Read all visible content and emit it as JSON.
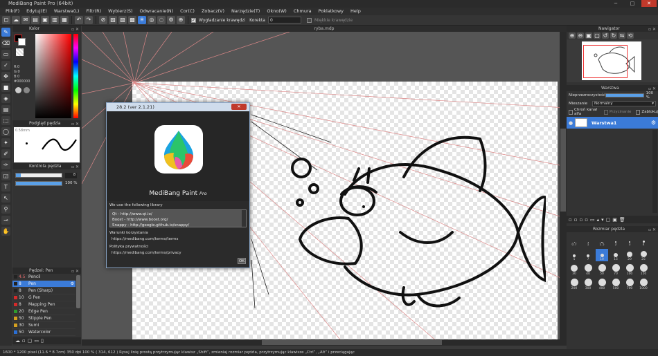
{
  "window": {
    "title": "MediBang Paint Pro (64bit)"
  },
  "window_controls": {
    "minimize": "─",
    "maximize": "□",
    "close": "✕"
  },
  "menu": [
    "Plik(F)",
    "Edytuj(E)",
    "Warstwa(L)",
    "Filtr(R)",
    "Wybierz(S)",
    "Odwracanie(N)",
    "Cor(C)",
    "Zobacz(V)",
    "Narzędzie(T)",
    "Okno(W)",
    "Chmura",
    "Poklatkowy",
    "Help"
  ],
  "toolbar": {
    "antialias_label": "Wygładzanie krawędzi",
    "correction_label": "Korekta",
    "correction_value": "0",
    "soft_edges_label": "Miękkie krawędzie"
  },
  "canvas": {
    "tab_title": "ryba.mdp"
  },
  "color_panel": {
    "title": "Kolor",
    "r": "R:0",
    "g": "G:0",
    "b": "B:0",
    "hex": "#000000"
  },
  "brush_preview": {
    "title": "Podgląd pędzla",
    "size": "0.58mm"
  },
  "brush_control": {
    "title": "Kontrola pędzla",
    "size_value": "8",
    "opacity_value": "100 %"
  },
  "brush_list": {
    "title": "Pędzel: Pen",
    "items": [
      {
        "size": "4.5",
        "name": "Pencil",
        "color": "#222222"
      },
      {
        "size": "8",
        "name": "Pen",
        "color": "#222222",
        "selected": true
      },
      {
        "size": "8",
        "name": "Pen (Sharp)",
        "color": "#222222"
      },
      {
        "size": "10",
        "name": "G Pen",
        "color": "#d42a2a"
      },
      {
        "size": "8",
        "name": "Mapping Pen",
        "color": "#d42a2a"
      },
      {
        "size": "20",
        "name": "Edge Pen",
        "color": "#2e9b2e"
      },
      {
        "size": "50",
        "name": "Stipple Pen",
        "color": "#d4a020"
      },
      {
        "size": "30",
        "name": "Sumi",
        "color": "#d4a020"
      },
      {
        "size": "50",
        "name": "Watercolor",
        "color": "#2a6fd4"
      }
    ]
  },
  "about_dialog": {
    "title": "28.2 (ver 2.1.21)",
    "close": "✕",
    "app_name": "MediBang Paint",
    "app_suffix": "Pro",
    "library_heading": "We use the following library",
    "libraries": [
      "Qt - http://www.qt.io/",
      "Boost - http://www.boost.org/",
      "Snappy - http://google.github.io/snappy/"
    ],
    "terms_label": "Warunki korzystania",
    "terms_url": "https://medibang.com/terms/terms",
    "privacy_label": "Polityka prywatności",
    "privacy_url": "https://medibang.com/terms/privacy",
    "ok": "OK"
  },
  "navigator": {
    "title": "Nawigator"
  },
  "layer_panel": {
    "title": "Warstwa",
    "opacity_label": "Nieprzezroczystość",
    "opacity_value": "100 %",
    "blend_label": "Mieszanie",
    "blend_value": "Normalny",
    "protect_alpha": "Chroń kanał alfa",
    "clipping": "Przycinanie",
    "lock": "Zablokuj",
    "layer_name": "Warstwa1"
  },
  "brush_size_panel": {
    "title": "Rozmiar pędzla",
    "sizes": [
      "1",
      "1.5",
      "2",
      "3",
      "4",
      "5",
      "7",
      "10",
      "15",
      "20",
      "25",
      "30",
      "40",
      "50",
      "70",
      "100",
      "150",
      "200",
      "300",
      "400",
      "500",
      "700",
      "1000"
    ],
    "extra": "0.7"
  },
  "status": {
    "text": "1600 * 1200 pixel   (11.6 * 8.7cm)   350 dpi   100 %   ( 314, 612 )   Rysuj linię prostą przytrzymując klawisz „Shift”, zmieniaj rozmiar pędzla, przytrzymując klawisze „Ctrl”, „Alt” i przeciągając"
  }
}
